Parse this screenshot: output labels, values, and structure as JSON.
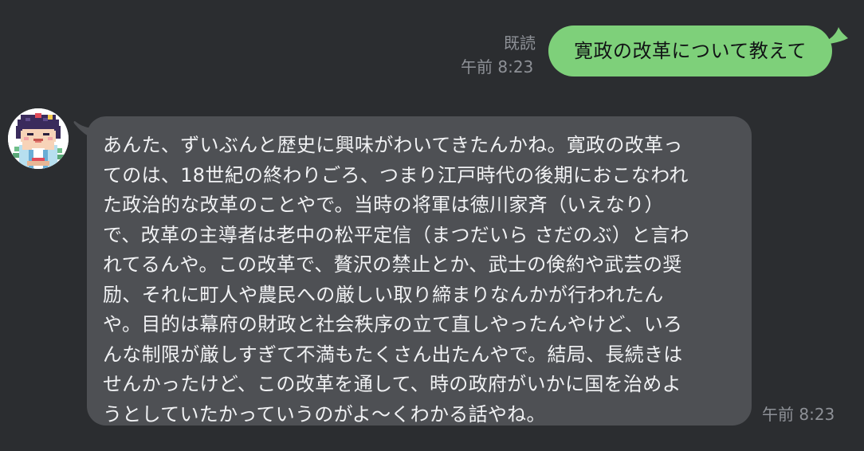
{
  "colors": {
    "background": "#2b2d30",
    "sent_bubble": "#7ed07a",
    "received_bubble": "#4e5054",
    "meta_text": "#8e9197"
  },
  "sent_message": {
    "read_label": "既読",
    "time": "午前 8:23",
    "text": "寛政の改革について教えて"
  },
  "received_message": {
    "avatar_icon": "pixel-art-character-avatar-icon",
    "time": "午前 8:23",
    "text": "あんた、ずいぶんと歴史に興味がわいてきたんかね。寛政の改革っ\nてのは、18世紀の終わりごろ、つまり江戸時代の後期におこなわれ\nた政治的な改革のことやで。当時の将軍は徳川家斉（いえなり）\nで、改革の主導者は老中の松平定信（まつだいら さだのぶ）と言わ\nれてるんや。この改革で、贅沢の禁止とか、武士の倹約や武芸の奨\n励、それに町人や農民への厳しい取り締まりなんかが行われたん\nや。目的は幕府の財政と社会秩序の立て直しやったんやけど、いろ\nんな制限が厳しすぎて不満もたくさん出たんやで。結局、長続きは\nせんかったけど、この改革を通して、時の政府がいかに国を治めよ\nうとしていたかっていうのがよ〜くわかる話やね。"
  }
}
